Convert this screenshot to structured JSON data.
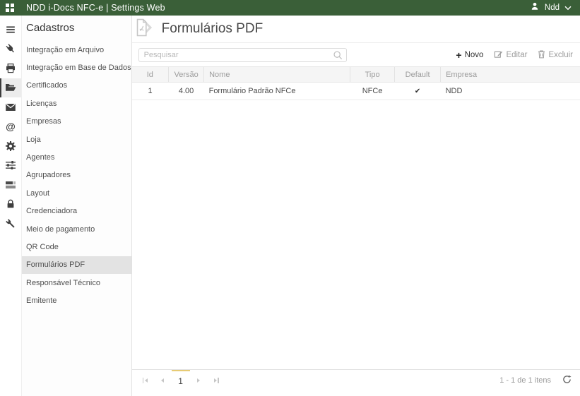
{
  "topbar": {
    "app_title": "NDD i-Docs NFC-e | Settings Web",
    "user_name": "Ndd",
    "brand_color": "#3a5f38"
  },
  "icon_strip": {
    "at_glyph": "@",
    "icons": [
      "menu-icon",
      "plug-icon",
      "printer-icon",
      "folder-open-icon",
      "envelope-icon",
      "at-sign-icon",
      "gear-icon",
      "sliders-icon",
      "server-icon",
      "lock-icon",
      "wrench-icon"
    ],
    "selected_icon": "folder-open-icon"
  },
  "sidebar": {
    "heading": "Cadastros",
    "items": [
      {
        "label": "Integração em Arquivo",
        "selected": false
      },
      {
        "label": "Integração em Base de Dados",
        "selected": false
      },
      {
        "label": "Certificados",
        "selected": false
      },
      {
        "label": "Licenças",
        "selected": false
      },
      {
        "label": "Empresas",
        "selected": false
      },
      {
        "label": "Loja",
        "selected": false
      },
      {
        "label": "Agentes",
        "selected": false
      },
      {
        "label": "Agrupadores",
        "selected": false
      },
      {
        "label": "Layout",
        "selected": false
      },
      {
        "label": "Credenciadora",
        "selected": false
      },
      {
        "label": "Meio de pagamento",
        "selected": false
      },
      {
        "label": "QR Code",
        "selected": false
      },
      {
        "label": "Formulários PDF",
        "selected": true
      },
      {
        "label": "Responsável Técnico",
        "selected": false
      },
      {
        "label": "Emitente",
        "selected": false
      }
    ]
  },
  "main": {
    "page_title": "Formulários PDF",
    "search": {
      "placeholder": "Pesquisar",
      "value": ""
    },
    "toolbar": {
      "new_glyph": "+",
      "new_label": "Novo",
      "edit_label": "Editar",
      "delete_label": "Excluir"
    },
    "table": {
      "columns": [
        "Id",
        "Versão",
        "Nome",
        "Tipo",
        "Default",
        "Empresa"
      ],
      "rows": [
        {
          "id": "1",
          "versao": "4.00",
          "nome": "Formulário Padrão NFCe",
          "tipo": "NFCe",
          "default_check": "✔",
          "empresa": "NDD"
        }
      ]
    },
    "pager": {
      "current_page": "1",
      "summary": "1 - 1 de 1 itens",
      "accent_color": "#e7cb74"
    }
  }
}
